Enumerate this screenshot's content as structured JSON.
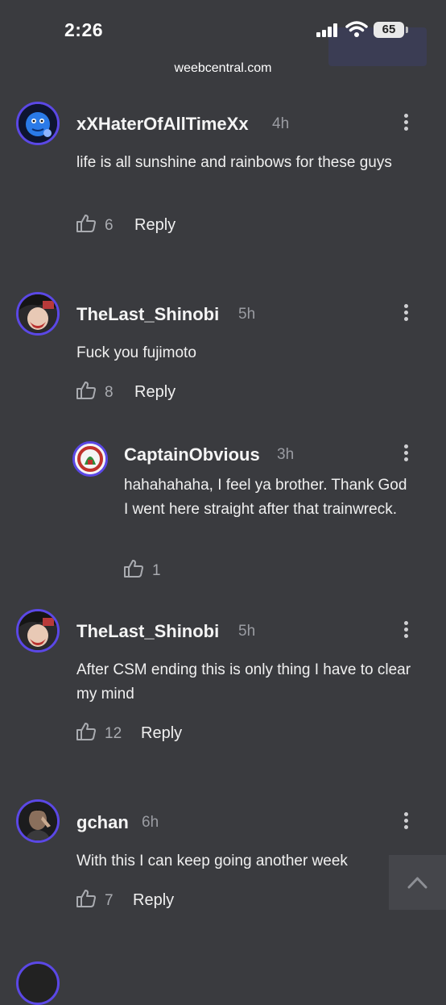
{
  "status_bar": {
    "time": "2:26",
    "battery": "65"
  },
  "browser": {
    "url": "weebcentral.com"
  },
  "comments": [
    {
      "username": "xXHaterOfAllTimeXx",
      "time": "4h",
      "text": "life is all sunshine and rainbows for these guys",
      "likes": "6",
      "reply_label": "Reply",
      "avatar": "blue-ball-avatar"
    },
    {
      "username": "TheLast_Shinobi",
      "time": "5h",
      "text": "Fuck you fujimoto",
      "likes": "8",
      "reply_label": "Reply",
      "avatar": "anime-character-avatar"
    },
    {
      "username": "CaptainObvious",
      "time": "3h",
      "text": "hahahahaha, I feel ya brother. Thank God I went here straight after that trainwreck.",
      "likes": "1",
      "avatar": "emblem-avatar"
    },
    {
      "username": "TheLast_Shinobi",
      "time": "5h",
      "text": "After CSM ending this is only thing I have to clear my mind",
      "likes": "12",
      "reply_label": "Reply",
      "avatar": "anime-character-avatar"
    },
    {
      "username": "gchan",
      "time": "6h",
      "text": "With this I can keep going another week",
      "likes": "7",
      "reply_label": "Reply",
      "avatar": "person-photo-avatar"
    }
  ]
}
